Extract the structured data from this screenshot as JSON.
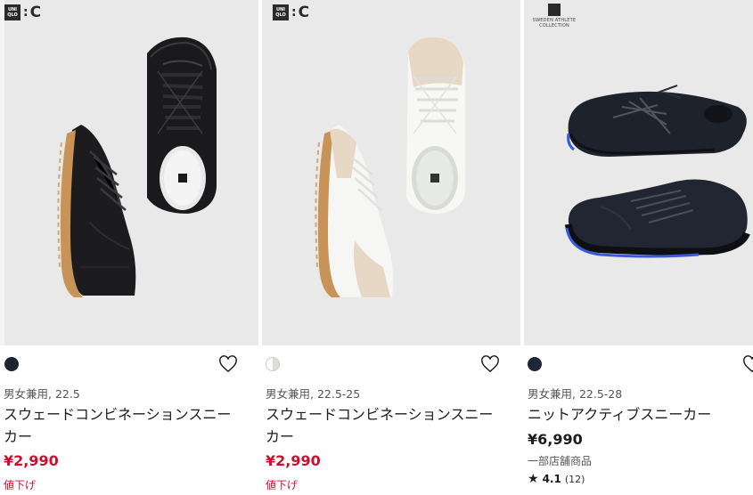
{
  "products": [
    {
      "logo_box": "UNI QLO",
      "logo_colon": ":",
      "logo_c": "C",
      "swatch_color": "#1d2430",
      "meta": "男女兼用, 22.5",
      "name": "スウェードコンビネーションスニーカー",
      "price": "¥2,990",
      "badge": "値下げ"
    },
    {
      "logo_box": "UNI QLO",
      "logo_colon": ":",
      "logo_c": "C",
      "swatch_color": "#f1f1ee",
      "meta": "男女兼用, 22.5-25",
      "name": "スウェードコンビネーションスニーカー",
      "price": "¥2,990",
      "badge": "値下げ"
    },
    {
      "logo_text": "SWEDEN ATHLETE COLLECTION",
      "swatch_color": "#1e2638",
      "meta": "男女兼用, 22.5-28",
      "name": "ニットアクティブスニーカー",
      "price": "¥6,990",
      "note": "一部店舗商品",
      "rating": {
        "star": "★",
        "value": "4.1",
        "count": "(12)"
      }
    }
  ],
  "colors": {
    "sale": "#c8102e",
    "image_bg": "#e9e9ea"
  }
}
